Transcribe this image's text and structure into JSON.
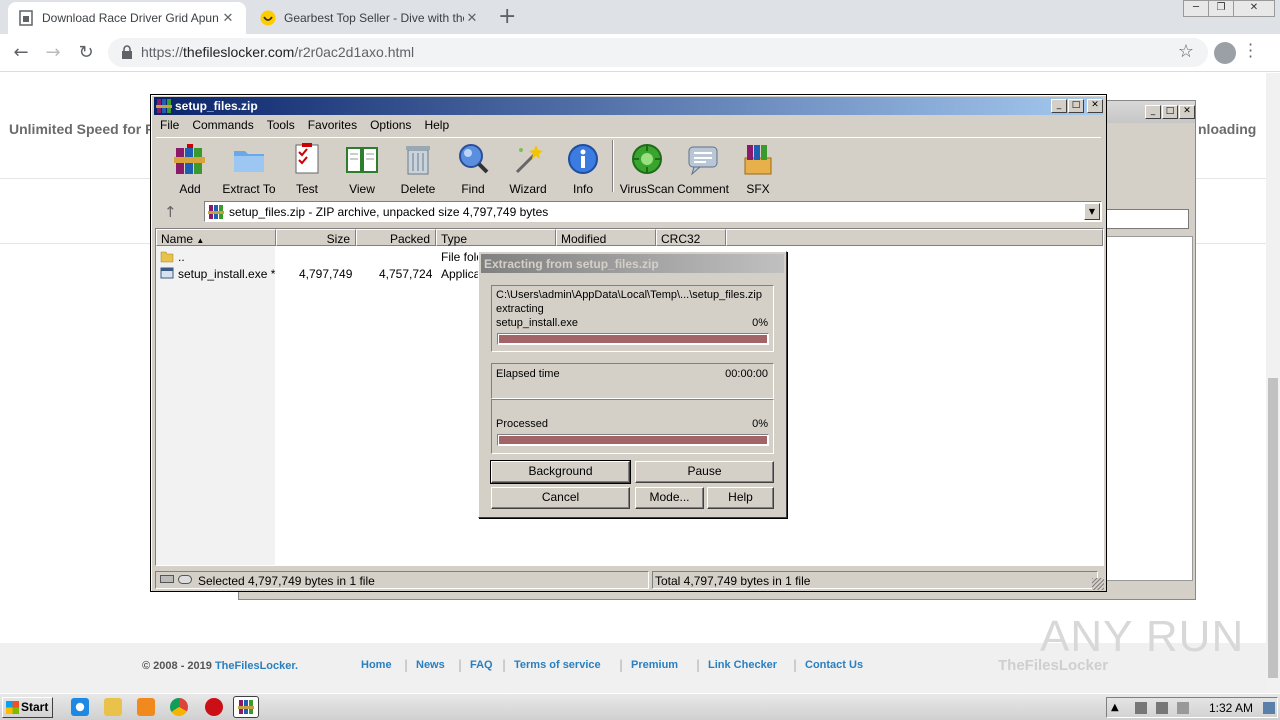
{
  "browser": {
    "tabs": [
      {
        "title": "Download Race Driver Grid Apun Ka"
      },
      {
        "title": "Gearbest Top Seller - Dive with the C"
      }
    ],
    "url_host": "thefileslocker.com",
    "url_path": "/r2r0ac2d1axo.html",
    "url_scheme": "https://"
  },
  "page": {
    "header_left": "Unlimited Speed for P",
    "header_right": "nloading",
    "footer": {
      "copyright": "© 2008 - 2019",
      "brand": "TheFilesLocker.",
      "links": [
        "Home",
        "News",
        "FAQ",
        "Terms of service",
        "Premium",
        "Link Checker",
        "Contact Us"
      ],
      "logo_text": "TheFilesLocker"
    },
    "watermark": "ANY RUN"
  },
  "winrar": {
    "title": "setup_files.zip",
    "menu": [
      "File",
      "Commands",
      "Tools",
      "Favorites",
      "Options",
      "Help"
    ],
    "toolbar": [
      {
        "label": "Add",
        "icon": "books-icon"
      },
      {
        "label": "Extract To",
        "icon": "folder-icon"
      },
      {
        "label": "Test",
        "icon": "checklist-icon"
      },
      {
        "label": "View",
        "icon": "book-icon"
      },
      {
        "label": "Delete",
        "icon": "trash-icon"
      },
      {
        "label": "Find",
        "icon": "magnifier-icon"
      },
      {
        "label": "Wizard",
        "icon": "wand-icon"
      },
      {
        "label": "Info",
        "icon": "info-icon"
      },
      {
        "label": "VirusScan",
        "icon": "virus-icon"
      },
      {
        "label": "Comment",
        "icon": "comment-icon"
      },
      {
        "label": "SFX",
        "icon": "sfx-icon"
      }
    ],
    "path": "setup_files.zip - ZIP archive, unpacked size 4,797,749 bytes",
    "columns": [
      "Name",
      "Size",
      "Packed",
      "Type",
      "Modified",
      "CRC32"
    ],
    "rows": [
      {
        "name": "..",
        "size": "",
        "packed": "",
        "type": "File fold"
      },
      {
        "name": "setup_install.exe *",
        "size": "4,797,749",
        "packed": "4,757,724",
        "type": "Applicat"
      }
    ],
    "status_left": "Selected 4,797,749 bytes in 1 file",
    "status_right": "Total 4,797,749 bytes in 1 file"
  },
  "dialog": {
    "title": "Extracting from setup_files.zip",
    "source_path": "C:\\Users\\admin\\AppData\\Local\\Temp\\...\\setup_files.zip",
    "action": "extracting",
    "file": "setup_install.exe",
    "file_percent": "0%",
    "elapsed_label": "Elapsed time",
    "elapsed_value": "00:00:00",
    "processed_label": "Processed",
    "processed_percent": "0%",
    "file_progress": 0,
    "total_progress": 0,
    "buttons": {
      "background": "Background",
      "pause": "Pause",
      "cancel": "Cancel",
      "mode": "Mode...",
      "help": "Help"
    }
  },
  "taskbar": {
    "start": "Start",
    "clock": "1:32 AM"
  }
}
